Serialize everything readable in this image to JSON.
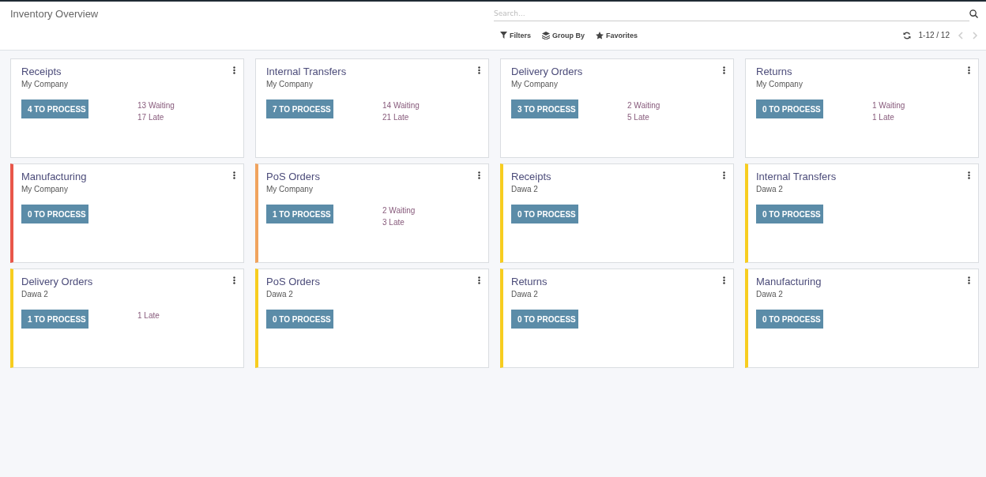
{
  "header": {
    "title": "Inventory Overview",
    "search": {
      "placeholder": "Search..."
    },
    "filters": [
      "Filters",
      "Group By",
      "Favorites"
    ],
    "pager": "1-12 / 12"
  },
  "cards": [
    {
      "title": "Receipts",
      "company": "My Company",
      "button": "4 TO PROCESS",
      "stats": [
        "13 Waiting",
        "17 Late"
      ]
    },
    {
      "title": "Internal Transfers",
      "company": "My Company",
      "button": "7 TO PROCESS",
      "stats": [
        "14 Waiting",
        "21 Late"
      ]
    },
    {
      "title": "Delivery Orders",
      "company": "My Company",
      "button": "3 TO PROCESS",
      "stats": [
        "2 Waiting",
        "5 Late"
      ]
    },
    {
      "title": "Returns",
      "company": "My Company",
      "button": "0 TO PROCESS",
      "stats": [
        "1 Waiting",
        "1 Late"
      ]
    },
    {
      "title": "Manufacturing",
      "company": "My Company",
      "button": "0 TO PROCESS",
      "color": "#e8574a"
    },
    {
      "title": "PoS Orders",
      "company": "My Company",
      "button": "1 TO PROCESS",
      "stats": [
        "2 Waiting",
        "3 Late"
      ],
      "color": "#f0a35e"
    },
    {
      "title": "Receipts",
      "company": "Dawa 2",
      "button": "0 TO PROCESS",
      "color": "#f7cd1f"
    },
    {
      "title": "Internal Transfers",
      "company": "Dawa 2",
      "button": "0 TO PROCESS",
      "color": "#f7cd1f"
    },
    {
      "title": "Delivery Orders",
      "company": "Dawa 2",
      "button": "1 TO PROCESS",
      "stats": [
        "1 Late"
      ],
      "color": "#f7cd1f"
    },
    {
      "title": "PoS Orders",
      "company": "Dawa 2",
      "button": "0 TO PROCESS",
      "color": "#f7cd1f"
    },
    {
      "title": "Returns",
      "company": "Dawa 2",
      "button": "0 TO PROCESS",
      "color": "#f7cd1f"
    },
    {
      "title": "Manufacturing",
      "company": "Dawa 2",
      "button": "0 TO PROCESS",
      "color": "#f7cd1f"
    }
  ]
}
